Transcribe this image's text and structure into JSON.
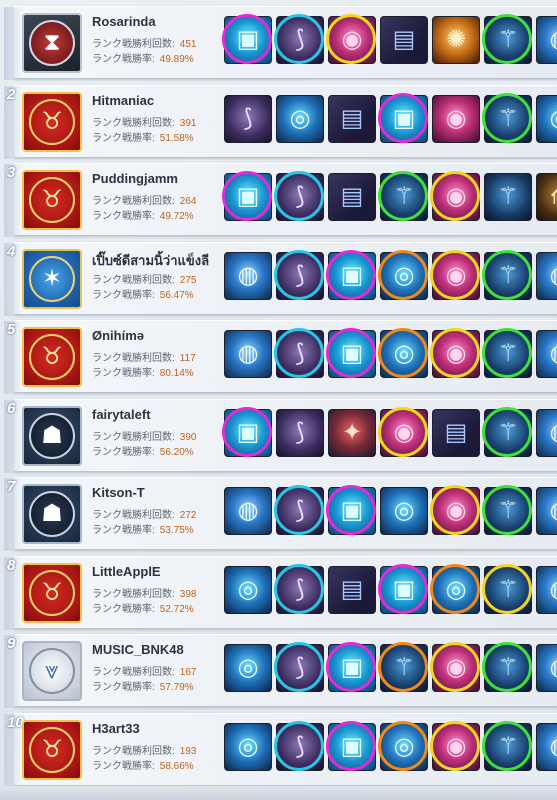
{
  "leaderboard": {
    "labels": {
      "wins": "ランク戦勝利回数:",
      "winrate": "ランク戦勝率:"
    },
    "ring_colors": {
      "magenta": "#e12bd9",
      "cyan": "#27c6e6",
      "yellow": "#f2d51c",
      "green": "#3fe03a",
      "orange": "#ef8a1a",
      "none": "transparent"
    },
    "item_glyphs": {
      "cube": "▣",
      "boots": "⟆",
      "orb": "◉",
      "book": "▤",
      "gold": "✺",
      "staff": "⚚",
      "ring": "◎",
      "claw": "⟰",
      "bubble": "◍",
      "gadget": "✦"
    },
    "players": [
      {
        "rank": "",
        "name": "Rosarinda",
        "wins": "451",
        "winrate": "49.89%",
        "emblem": {
          "style": "dark",
          "icon": "widow-icon",
          "glyph": "⧗"
        },
        "items": [
          {
            "type": "cube",
            "ring": "magenta"
          },
          {
            "type": "boots",
            "ring": "cyan"
          },
          {
            "type": "orb",
            "ring": "yellow"
          },
          {
            "type": "book",
            "ring": "none"
          },
          {
            "type": "gold",
            "ring": "none"
          },
          {
            "type": "staff",
            "ring": "green"
          },
          {
            "type": "bubble",
            "ring": "none"
          }
        ]
      },
      {
        "rank": "2",
        "name": "Hitmaniac",
        "wins": "391",
        "winrate": "51.58%",
        "emblem": {
          "style": "red",
          "icon": "bull-icon",
          "glyph": "♉"
        },
        "items": [
          {
            "type": "boots",
            "ring": "none"
          },
          {
            "type": "ring",
            "ring": "none"
          },
          {
            "type": "book",
            "ring": "none"
          },
          {
            "type": "cube",
            "ring": "magenta"
          },
          {
            "type": "orb",
            "ring": "none"
          },
          {
            "type": "staff",
            "ring": "green"
          },
          {
            "type": "ring",
            "ring": "none"
          }
        ]
      },
      {
        "rank": "3",
        "name": "Puddingjamm",
        "wins": "264",
        "winrate": "49.72%",
        "emblem": {
          "style": "red",
          "icon": "bull-2021-icon",
          "glyph": "♉"
        },
        "items": [
          {
            "type": "cube",
            "ring": "magenta"
          },
          {
            "type": "boots",
            "ring": "cyan"
          },
          {
            "type": "book",
            "ring": "none"
          },
          {
            "type": "staff",
            "ring": "green"
          },
          {
            "type": "orb",
            "ring": "yellow"
          },
          {
            "type": "staff",
            "ring": "none"
          },
          {
            "type": "claw",
            "ring": "none"
          }
        ]
      },
      {
        "rank": "4",
        "name": "เปิ๊บซ์ดีสามนิ้ว่าแข็งลี",
        "wins": "275",
        "winrate": "56.47%",
        "emblem": {
          "style": "blue",
          "icon": "star-emblem-icon",
          "glyph": "✶"
        },
        "items": [
          {
            "type": "bubble",
            "ring": "none"
          },
          {
            "type": "boots",
            "ring": "cyan"
          },
          {
            "type": "cube",
            "ring": "magenta"
          },
          {
            "type": "ring",
            "ring": "orange"
          },
          {
            "type": "orb",
            "ring": "yellow"
          },
          {
            "type": "staff",
            "ring": "green"
          },
          {
            "type": "bubble",
            "ring": "none"
          }
        ]
      },
      {
        "rank": "5",
        "name": "Ønihímə",
        "wins": "117",
        "winrate": "80.14%",
        "emblem": {
          "style": "red",
          "icon": "bull-icon",
          "glyph": "♉"
        },
        "items": [
          {
            "type": "bubble",
            "ring": "none"
          },
          {
            "type": "boots",
            "ring": "cyan"
          },
          {
            "type": "cube",
            "ring": "magenta"
          },
          {
            "type": "ring",
            "ring": "orange"
          },
          {
            "type": "orb",
            "ring": "yellow"
          },
          {
            "type": "staff",
            "ring": "green"
          },
          {
            "type": "bubble",
            "ring": "none"
          }
        ]
      },
      {
        "rank": "6",
        "name": "fairytaleft",
        "wins": "390",
        "winrate": "56.20%",
        "emblem": {
          "style": "panther",
          "icon": "panther-icon",
          "glyph": "☗"
        },
        "items": [
          {
            "type": "cube",
            "ring": "magenta"
          },
          {
            "type": "boots",
            "ring": "none"
          },
          {
            "type": "gadget",
            "ring": "none"
          },
          {
            "type": "orb",
            "ring": "yellow"
          },
          {
            "type": "book",
            "ring": "none"
          },
          {
            "type": "staff",
            "ring": "green"
          },
          {
            "type": "bubble",
            "ring": "none"
          }
        ]
      },
      {
        "rank": "7",
        "name": "Kitson-T",
        "wins": "272",
        "winrate": "53.75%",
        "emblem": {
          "style": "panther",
          "icon": "panther-icon",
          "glyph": "☗"
        },
        "items": [
          {
            "type": "bubble",
            "ring": "none"
          },
          {
            "type": "boots",
            "ring": "cyan"
          },
          {
            "type": "cube",
            "ring": "magenta"
          },
          {
            "type": "ring",
            "ring": "none"
          },
          {
            "type": "orb",
            "ring": "yellow"
          },
          {
            "type": "staff",
            "ring": "green"
          },
          {
            "type": "bubble",
            "ring": "none"
          }
        ]
      },
      {
        "rank": "8",
        "name": "LittleApplE",
        "wins": "398",
        "winrate": "52.72%",
        "emblem": {
          "style": "red",
          "icon": "bull-icon",
          "glyph": "♉"
        },
        "items": [
          {
            "type": "ring",
            "ring": "none"
          },
          {
            "type": "boots",
            "ring": "cyan"
          },
          {
            "type": "book",
            "ring": "none"
          },
          {
            "type": "cube",
            "ring": "magenta"
          },
          {
            "type": "ring",
            "ring": "orange"
          },
          {
            "type": "staff",
            "ring": "yellow"
          },
          {
            "type": "bubble",
            "ring": "none"
          }
        ]
      },
      {
        "rank": "9",
        "name": "MUSIC_BNK48",
        "wins": "167",
        "winrate": "57.79%",
        "emblem": {
          "style": "silver",
          "icon": "chevron-rank-icon",
          "glyph": "⩔"
        },
        "items": [
          {
            "type": "ring",
            "ring": "none"
          },
          {
            "type": "boots",
            "ring": "cyan"
          },
          {
            "type": "cube",
            "ring": "magenta"
          },
          {
            "type": "staff",
            "ring": "orange"
          },
          {
            "type": "orb",
            "ring": "yellow"
          },
          {
            "type": "staff",
            "ring": "green"
          },
          {
            "type": "bubble",
            "ring": "none"
          }
        ]
      },
      {
        "rank": "10",
        "name": "H3art33",
        "wins": "193",
        "winrate": "58.66%",
        "emblem": {
          "style": "red",
          "icon": "bull-icon",
          "glyph": "♉"
        },
        "items": [
          {
            "type": "ring",
            "ring": "none"
          },
          {
            "type": "boots",
            "ring": "cyan"
          },
          {
            "type": "cube",
            "ring": "magenta"
          },
          {
            "type": "ring",
            "ring": "orange"
          },
          {
            "type": "orb",
            "ring": "yellow"
          },
          {
            "type": "staff",
            "ring": "green"
          },
          {
            "type": "bubble",
            "ring": "none"
          }
        ]
      }
    ]
  }
}
